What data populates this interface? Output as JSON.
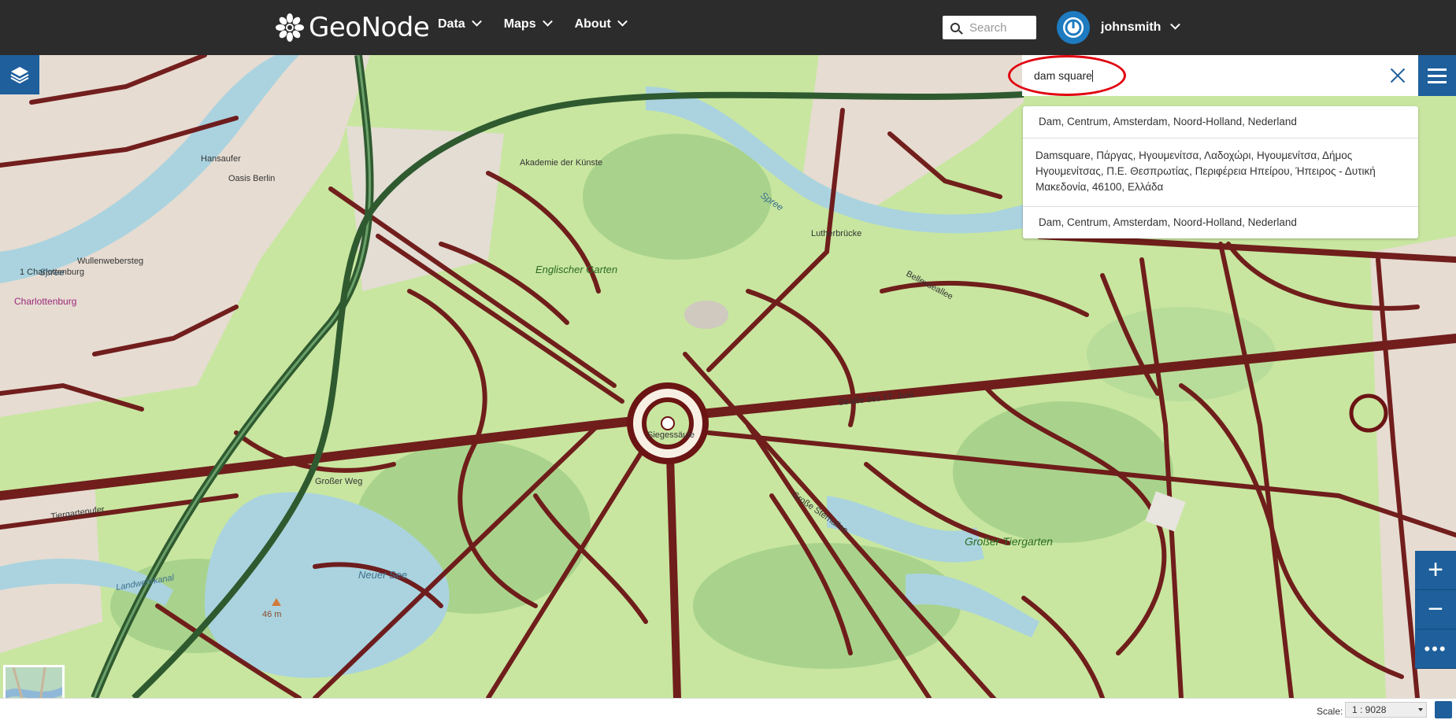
{
  "navbar": {
    "brand": "GeoNode",
    "menu": [
      {
        "label": "Data"
      },
      {
        "label": "Maps"
      },
      {
        "label": "About"
      }
    ],
    "search_placeholder": "Search",
    "username": "johnsmith"
  },
  "map": {
    "labels": {
      "spree_1": "Spree",
      "spree_2": "Spree",
      "englischer_garten": "Englischer Garten",
      "grosser_tiergarten": "Großer Tiergarten",
      "neuer_see": "Neuer See",
      "charlottenburg": "Charlottenburg",
      "oasis_berlin": "Oasis Berlin",
      "hansaufer": "Hansaufer",
      "wullenwebersteg": "Wullenwebersteg",
      "luther_bruecke": "Lutherbrücke",
      "siegessaeule": "Siegessäule",
      "elevation": "46 m",
      "akademie": "Akademie der Künste",
      "strasse_des_17_juni": "Straße des 17. Juni",
      "bellevueallee": "Bellevueallee",
      "grosser_weg": "Großer Weg",
      "grosse_sternallee": "Große Sternallee",
      "tiergartenufer": "Tiergartenufer",
      "landwehrkanal": "Landwehrkanal",
      "hansa_1": "1 Charlottenburg"
    },
    "colors": {
      "park": "#c8e6a0",
      "park_dark": "#a9d38c",
      "water": "#aad3df",
      "road": "#6b1414",
      "urban": "#e6dcd2",
      "railway": "#2f5a2f"
    }
  },
  "geo_search": {
    "value": "dam square",
    "results": [
      "Dam, Centrum, Amsterdam, Noord-Holland, Nederland",
      "Damsquare, Πάργας, Ηγουμενίτσα, Λαδοχώρι, Ηγουμενίτσα, Δήμος Ηγουμενίτσας, Π.Ε. Θεσπρωτίας, Περιφέρεια Ηπείρου, Ήπειρος - Δυτική Μακεδονία, 46100, Ελλάδα",
      "Dam, Centrum, Amsterdam, Noord-Holland, Nederland"
    ]
  },
  "zoom": {
    "in": "+",
    "out": "−",
    "more": "•••"
  },
  "footer": {
    "scale_label": "Scale:",
    "scale_value": "1 : 9028"
  }
}
